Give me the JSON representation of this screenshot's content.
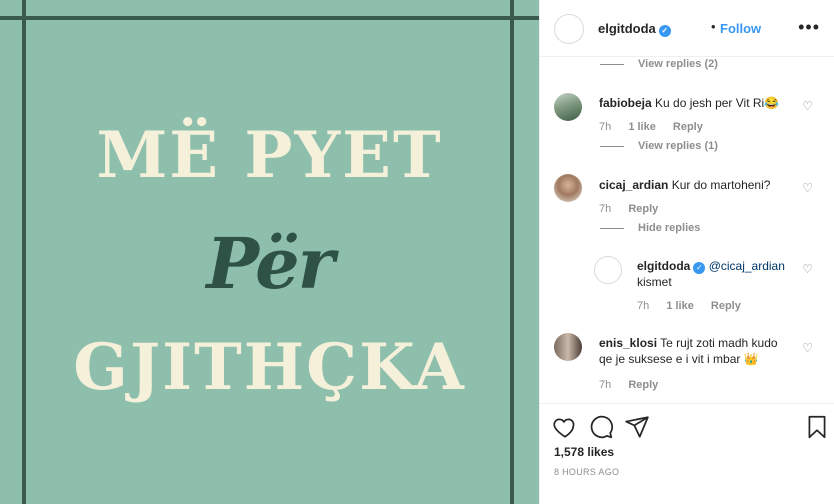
{
  "poster": {
    "line1": "MË PYET",
    "line2": "Për",
    "line3": "GJITHÇKA",
    "background": "#8ebfad",
    "cream": "#f4f0da",
    "dark_green": "#2f5246"
  },
  "header": {
    "username": "elgitdoda",
    "verified_icon": "verified-badge-icon",
    "separator": "•",
    "follow_label": "Follow",
    "more_icon": "ellipsis-icon"
  },
  "comments": {
    "view_replies_top": "View replies (2)",
    "items": [
      {
        "user": "fabiobeja",
        "text": "Ku do jesh per Vit Ri😂",
        "time": "7h",
        "likes": "1 like",
        "reply": "Reply",
        "view_replies": "View replies (1)"
      },
      {
        "user": "cicaj_ardian",
        "text": "Kur do martoheni?",
        "time": "7h",
        "reply": "Reply",
        "hide_replies": "Hide replies"
      },
      {
        "user": "elgitdoda",
        "mention": "@cicaj_ardian",
        "text": "kismet",
        "time": "7h",
        "likes": "1 like",
        "reply": "Reply"
      },
      {
        "user": "enis_klosi",
        "text": "Te rujt zoti madh kudo qe je suksese e i vit i mbar 👑",
        "time": "7h",
        "reply": "Reply"
      }
    ]
  },
  "footer": {
    "likes": "1,578 likes",
    "time_ago": "8 HOURS AGO",
    "icons": [
      "heart-icon",
      "comment-icon",
      "share-icon",
      "bookmark-icon"
    ]
  },
  "colors": {
    "link_blue": "#3897f0",
    "muted": "#8e8e8e",
    "text": "#262626"
  }
}
